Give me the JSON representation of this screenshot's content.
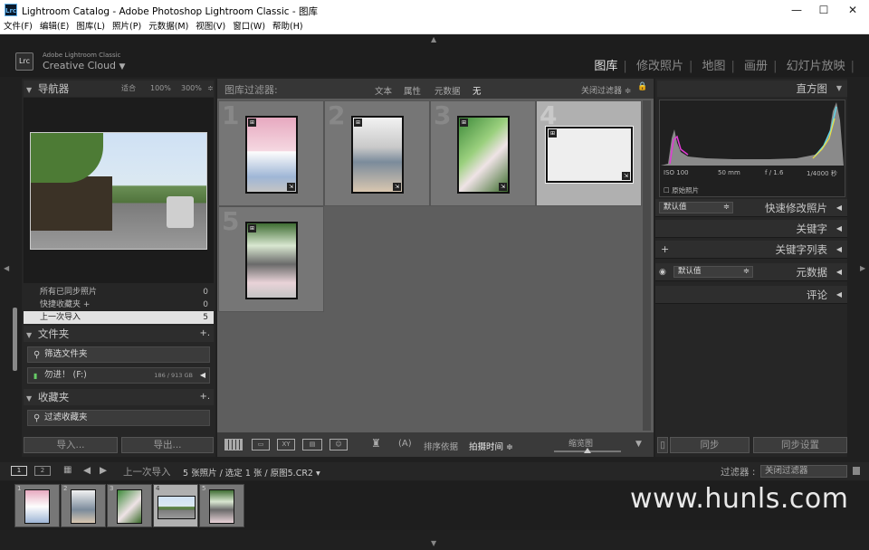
{
  "window": {
    "title": "Lightroom Catalog - Adobe Photoshop Lightroom Classic - 图库",
    "icon_label": "Lrc"
  },
  "menu": [
    "文件(F)",
    "编辑(E)",
    "图库(L)",
    "照片(P)",
    "元数据(M)",
    "视图(V)",
    "窗口(W)",
    "帮助(H)"
  ],
  "identity": {
    "badge": "Lrc",
    "line1": "Adobe Lightroom Classic",
    "line2": "Creative Cloud",
    "dropdown": "▼"
  },
  "modules": [
    {
      "label": "图库",
      "active": true
    },
    {
      "label": "修改照片",
      "active": false
    },
    {
      "label": "地图",
      "active": false
    },
    {
      "label": "画册",
      "active": false
    },
    {
      "label": "幻灯片放映",
      "active": false
    }
  ],
  "navigator": {
    "title": "导航器",
    "fit": "适合",
    "zoom1": "100%",
    "zoom2": "300%"
  },
  "catalog_rows": [
    {
      "label": "所有已同步照片",
      "count": "0",
      "selected": false
    },
    {
      "label": "快捷收藏夹 +",
      "count": "0",
      "selected": false
    },
    {
      "label": "上一次导入",
      "count": "5",
      "selected": true
    }
  ],
  "folders": {
    "title": "文件夹",
    "add": "+.",
    "search_placeholder": "筛选文件夹",
    "volume": "勿进！ (F:)",
    "volume_size": "186 / 913 GB"
  },
  "collections": {
    "title": "收藏夹",
    "add": "+.",
    "search_placeholder": "过滤收藏夹"
  },
  "left_buttons": {
    "import": "导入...",
    "export": "导出..."
  },
  "filter_bar": {
    "title": "图库过滤器:",
    "options": [
      "文本",
      "属性",
      "元数据",
      "无"
    ],
    "active": "无",
    "preset": "关闭过滤器 ≑",
    "lock": "🔒"
  },
  "grid": [
    {
      "num": "1",
      "selected": false
    },
    {
      "num": "2",
      "selected": false
    },
    {
      "num": "3",
      "selected": false
    },
    {
      "num": "4",
      "selected": true
    },
    {
      "num": "5",
      "selected": false
    }
  ],
  "toolbar": {
    "sort_label": "排序依据",
    "sort_value": "拍摄时间 ≑",
    "thumb_label": "缩览图"
  },
  "histogram": {
    "title": "直方图",
    "iso": "ISO 100",
    "focal": "50 mm",
    "aperture": "f / 1.6",
    "shutter": "1/4000 秒",
    "original": "原始照片"
  },
  "right_panels": {
    "quick_develop": "快速修改照片",
    "quick_develop_preset": "默认值",
    "keywording": "关键字",
    "keyword_list": "关键字列表",
    "metadata": "元数据",
    "metadata_preset": "默认值",
    "comments": "评论"
  },
  "right_buttons": {
    "sync": "同步",
    "sync_settings": "同步设置"
  },
  "filmstrip_bar": {
    "screen1": "1",
    "screen2": "2",
    "source": "上一次导入",
    "count_text": "5 张照片 / 选定 1 张 / 原图5.CR2 ▾",
    "filter_label": "过滤器 :",
    "filter_value": "关闭过滤器"
  },
  "filmstrip": [
    {
      "num": "1",
      "selected": false
    },
    {
      "num": "2",
      "selected": false
    },
    {
      "num": "3",
      "selected": false
    },
    {
      "num": "4",
      "selected": true
    },
    {
      "num": "5",
      "selected": false
    }
  ],
  "watermark": "www.hunls.com",
  "colors": {
    "accent": "#e4e4e4",
    "panel": "#262626",
    "grid_bg": "#5e5e5e",
    "selected_cell": "#b0b0b0"
  }
}
